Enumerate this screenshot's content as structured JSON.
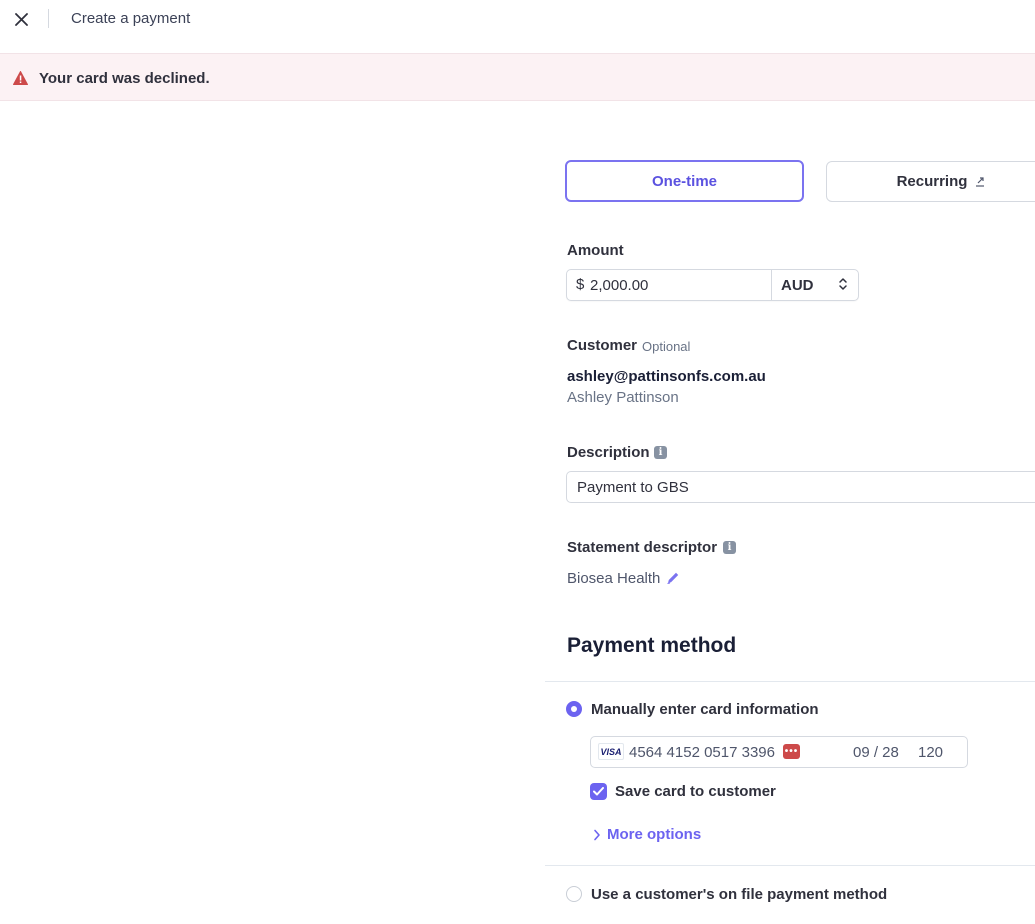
{
  "header": {
    "title": "Create a payment",
    "close_icon": "close-icon"
  },
  "banner": {
    "message": "Your card was declined.",
    "icon": "warning-icon",
    "color": "#cd4a4a"
  },
  "tabs": [
    {
      "label": "One-time",
      "selected": true
    },
    {
      "label": "Recurring",
      "icon": "external-link-icon",
      "selected": false
    }
  ],
  "amount": {
    "label": "Amount",
    "currency_symbol": "$",
    "value": "2,000.00",
    "currency": "AUD"
  },
  "customer": {
    "label": "Customer",
    "optional": "Optional",
    "email": "ashley@pattinsonfs.com.au",
    "name": "Ashley Pattinson"
  },
  "description": {
    "label": "Description",
    "value": "Payment to GBS",
    "icon": "info-icon"
  },
  "statement_descriptor": {
    "label": "Statement descriptor",
    "value": "Biosea Health",
    "icon": "info-icon",
    "edit_icon": "pencil-icon"
  },
  "payment_method": {
    "heading": "Payment method",
    "manual": {
      "label": "Manually enter card information",
      "selected": true
    },
    "card": {
      "brand": "VISA",
      "number": "4564 4152 0517 3396",
      "expiry": "09 / 28",
      "cvc": "120",
      "error_icon": "card-error-icon"
    },
    "save_card": {
      "label": "Save card to customer",
      "checked": true
    },
    "more_options": "More options",
    "on_file": {
      "label": "Use a customer's on file payment method",
      "selected": false
    }
  },
  "colors": {
    "accent": "#6c63f0",
    "error": "#cd4a4a",
    "banner_bg": "#fcf2f4"
  }
}
